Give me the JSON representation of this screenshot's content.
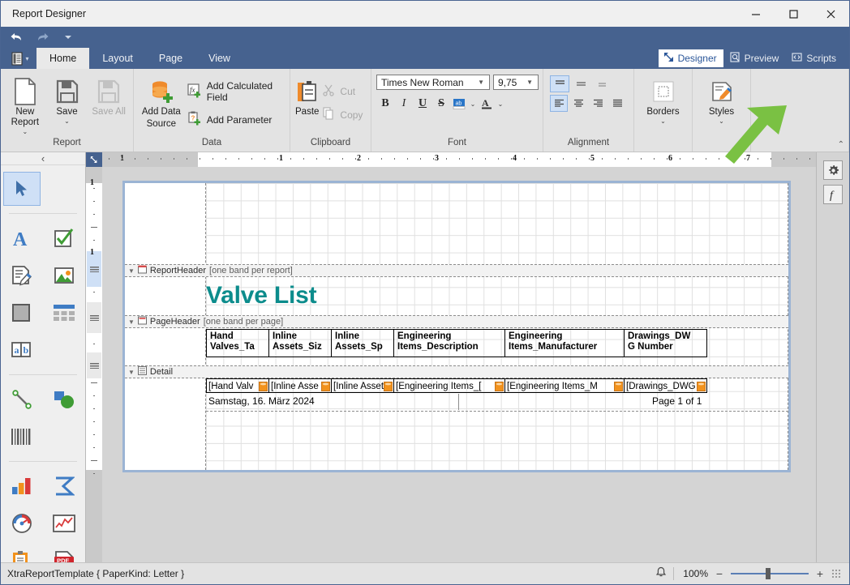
{
  "window": {
    "title": "Report Designer",
    "minimize": "minimize-icon",
    "maximize": "maximize-icon",
    "close": "close-icon"
  },
  "quick_access": {
    "undo": "undo-icon",
    "redo": "redo-icon",
    "more": "chevron-down-icon"
  },
  "ribbon": {
    "app_menu": "application-menu-icon",
    "tabs": [
      {
        "label": "Home",
        "active": true
      },
      {
        "label": "Layout",
        "active": false
      },
      {
        "label": "Page",
        "active": false
      },
      {
        "label": "View",
        "active": false
      }
    ],
    "view_tabs": [
      {
        "label": "Designer",
        "icon": "designer-icon",
        "active": true
      },
      {
        "label": "Preview",
        "icon": "preview-icon",
        "active": false
      },
      {
        "label": "Scripts",
        "icon": "scripts-icon",
        "active": false
      }
    ],
    "collapse": "chevron-up-icon",
    "groups": {
      "report": {
        "label": "Report",
        "new_report": "New Report",
        "save": "Save",
        "save_all": "Save All"
      },
      "data": {
        "label": "Data",
        "add_data_source": "Add Data\nSource",
        "add_data_source_line1": "Add Data",
        "add_data_source_line2": "Source",
        "add_calculated_field": "Add Calculated Field",
        "add_parameter": "Add Parameter"
      },
      "clipboard": {
        "label": "Clipboard",
        "paste": "Paste",
        "cut": "Cut",
        "copy": "Copy"
      },
      "font": {
        "label": "Font",
        "family_value": "Times New Roman",
        "size_value": "9,75",
        "bold": "B",
        "italic": "I",
        "underline": "U",
        "strikethrough": "S",
        "highlight": "ab",
        "font_color": "A"
      },
      "alignment": {
        "label": "Alignment"
      },
      "borders": {
        "label": "Borders"
      },
      "styles": {
        "label": "Styles"
      }
    }
  },
  "toolbox": {
    "collapse": "chevron-left-icon",
    "items": [
      {
        "name": "pointer-tool",
        "selected": true
      },
      {
        "name": "label-tool",
        "selected": false
      },
      {
        "name": "check-box-tool",
        "selected": false
      },
      {
        "name": "rich-text-tool",
        "selected": false
      },
      {
        "name": "picture-box-tool",
        "selected": false
      },
      {
        "name": "panel-tool",
        "selected": false
      },
      {
        "name": "table-tool",
        "selected": false
      },
      {
        "name": "character-comb-tool",
        "selected": false
      },
      {
        "name": "line-tool",
        "selected": false
      },
      {
        "name": "shape-tool",
        "selected": false
      },
      {
        "name": "barcode-tool",
        "selected": false
      },
      {
        "name": "chart-tool",
        "selected": false
      },
      {
        "name": "pivot-grid-tool",
        "selected": false
      },
      {
        "name": "gauge-tool",
        "selected": false
      },
      {
        "name": "sparkline-tool",
        "selected": false
      },
      {
        "name": "subreport-tool",
        "selected": false
      },
      {
        "name": "pdf-content-tool",
        "selected": false
      }
    ]
  },
  "rulers": {
    "horizontal_ticks": [
      "1",
      "1",
      "2",
      "3",
      "4",
      "5",
      "6",
      "7"
    ],
    "vertical_ticks": [
      "1",
      "1"
    ]
  },
  "report": {
    "bands": [
      {
        "name": "ReportHeader",
        "note": "[one band per report]",
        "icon": "report-header-icon"
      },
      {
        "name": "PageHeader",
        "note": "[one band per page]",
        "icon": "page-header-icon"
      },
      {
        "name": "Detail",
        "note": "",
        "icon": "detail-band-icon"
      }
    ],
    "title": "Valve List",
    "header_cells": [
      {
        "line1": "Hand",
        "line2": "Valves_Ta"
      },
      {
        "line1": "Inline",
        "line2": "Assets_Siz"
      },
      {
        "line1": "Inline",
        "line2": "Assets_Sp"
      },
      {
        "line1": "Engineering",
        "line2": "Items_Description"
      },
      {
        "line1": "Engineering",
        "line2": "Items_Manufacturer"
      },
      {
        "line1": "Drawings_DW",
        "line2": "G Number"
      }
    ],
    "detail_cells": [
      "[Hand Valv",
      "[Inline Asse",
      "[Inline Asset",
      "[Engineering Items_[",
      "[Engineering Items_M",
      "[Drawings_DWG"
    ],
    "footer_date": "Samstag, 16. März 2024",
    "footer_page": "Page 1 of 1"
  },
  "right_panel": {
    "buttons": [
      {
        "name": "properties-gear-icon",
        "glyph": "gear"
      },
      {
        "name": "expressions-function-icon",
        "glyph": "f"
      }
    ]
  },
  "status_bar": {
    "document": "XtraReportTemplate { PaperKind: Letter }",
    "notification": "bell-icon",
    "zoom": "100%",
    "zoom_out": "−",
    "zoom_in": "+",
    "resize_grip": "resize-grip-icon"
  },
  "annotation": {
    "arrow_color": "#7ac143",
    "points_to": "Designer"
  },
  "colors": {
    "ribbon_blue": "#46628f",
    "title_teal": "#0c8c8c",
    "accent_orange": "#f2921d",
    "selection_blue": "#cfe0f6"
  }
}
